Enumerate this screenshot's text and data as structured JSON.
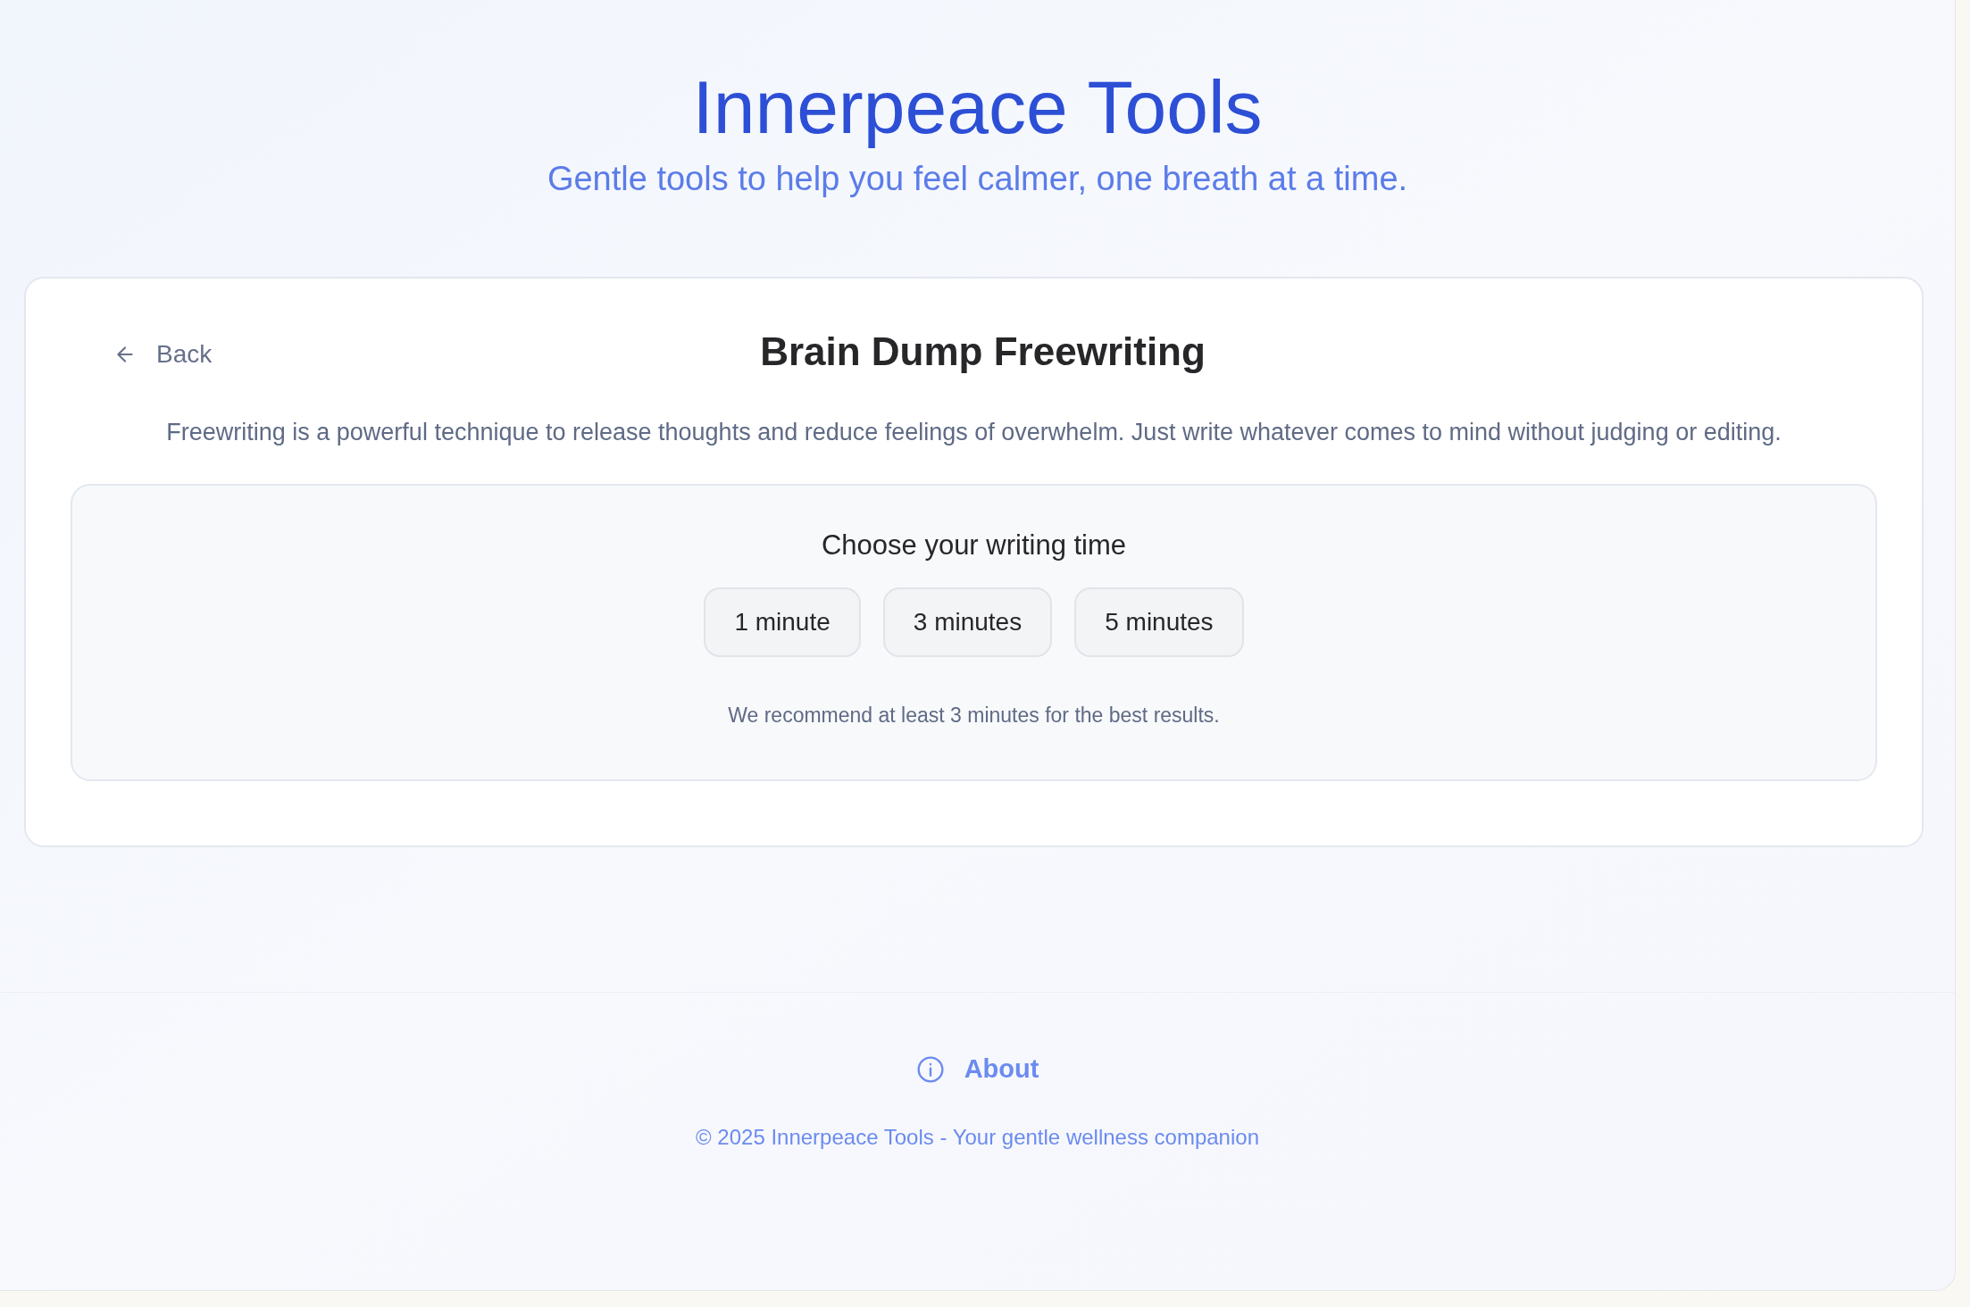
{
  "header": {
    "title": "Innerpeace Tools",
    "subtitle": "Gentle tools to help you feel calmer, one breath at a time."
  },
  "tool": {
    "back": "Back",
    "title": "Brain Dump Freewriting",
    "description": "Freewriting is a powerful technique to release thoughts and reduce feelings of overwhelm. Just write whatever comes to mind without judging or editing.",
    "time_picker": {
      "heading": "Choose your writing time",
      "options": [
        {
          "label": "1 minute",
          "selected": false
        },
        {
          "label": "3 minutes",
          "selected": false
        },
        {
          "label": "5 minutes",
          "selected": false
        }
      ],
      "note": "We recommend at least 3 minutes for the best results."
    }
  },
  "footer": {
    "about": "About",
    "copyright": "© 2025 Innerpeace Tools - Your gentle wellness companion"
  }
}
